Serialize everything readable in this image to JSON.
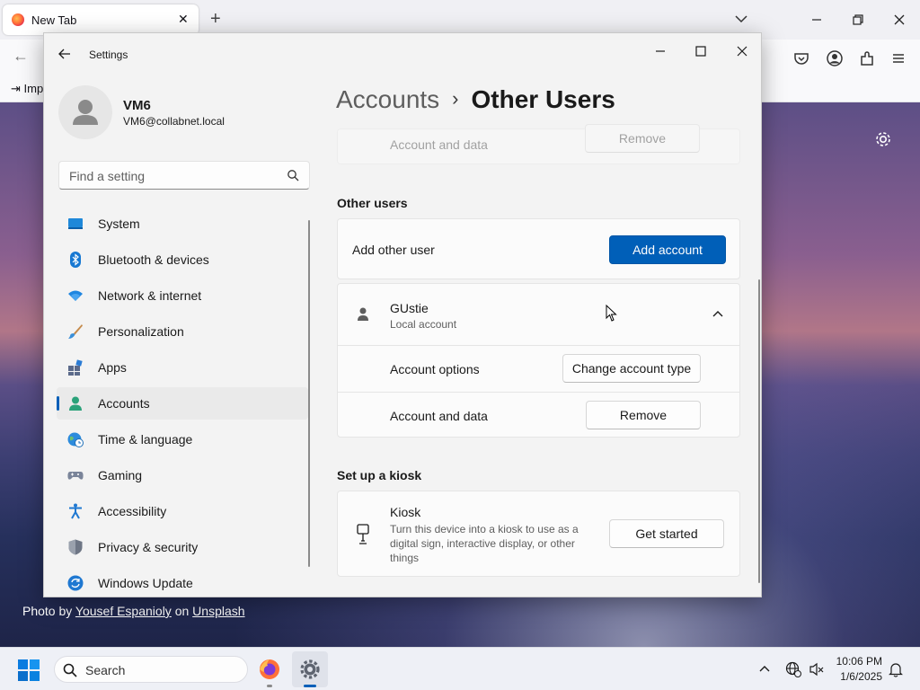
{
  "browser": {
    "tab_title": "New Tab",
    "tab_close": "✕",
    "new_tab": "+",
    "bookmark_item": "Imp",
    "photo_credit": {
      "prefix": "Photo by",
      "author": "Yousef Espanioly",
      "joiner": "on",
      "site": "Unsplash"
    }
  },
  "settings": {
    "window_title": "Settings",
    "profile": {
      "name": "VM6",
      "email": "VM6@collabnet.local"
    },
    "search_placeholder": "Find a setting",
    "nav": [
      {
        "label": "System",
        "icon": "system-icon"
      },
      {
        "label": "Bluetooth & devices",
        "icon": "bluetooth-icon"
      },
      {
        "label": "Network & internet",
        "icon": "wifi-icon"
      },
      {
        "label": "Personalization",
        "icon": "brush-icon"
      },
      {
        "label": "Apps",
        "icon": "apps-icon"
      },
      {
        "label": "Accounts",
        "icon": "accounts-icon",
        "active": true
      },
      {
        "label": "Time & language",
        "icon": "globe-clock-icon"
      },
      {
        "label": "Gaming",
        "icon": "gamepad-icon"
      },
      {
        "label": "Accessibility",
        "icon": "accessibility-icon"
      },
      {
        "label": "Privacy & security",
        "icon": "shield-icon"
      },
      {
        "label": "Windows Update",
        "icon": "update-icon"
      }
    ],
    "breadcrumb": {
      "parent": "Accounts",
      "separator": "›",
      "current": "Other Users"
    },
    "top_partial_row": {
      "label": "Account and data",
      "button": "Remove"
    },
    "other_users": {
      "section_title": "Other users",
      "add_label": "Add other user",
      "add_button": "Add account",
      "user": {
        "name": "GUstie",
        "type": "Local account",
        "options_label": "Account options",
        "options_button": "Change account type",
        "data_label": "Account and data",
        "data_button": "Remove"
      }
    },
    "kiosk": {
      "section_title": "Set up a kiosk",
      "title": "Kiosk",
      "desc_lines": [
        "Turn this device into a kiosk to use as a",
        "digital sign, interactive display, or other",
        "things"
      ],
      "button": "Get started"
    }
  },
  "taskbar": {
    "search_label": "Search",
    "time": "10:06 PM",
    "date": "1/6/2025"
  },
  "colors": {
    "accent": "#005fb8",
    "settings_bg": "#f3f3f3",
    "card_bg": "#fbfbfb"
  }
}
